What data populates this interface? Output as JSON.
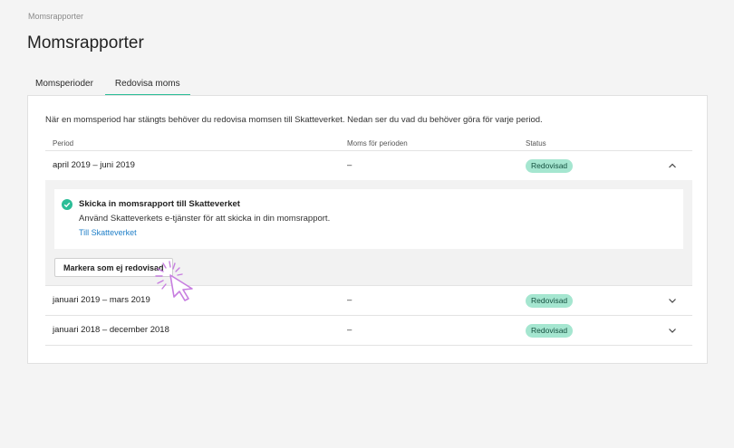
{
  "breadcrumb": "Momsrapporter",
  "page_title": "Momsrapporter",
  "tabs": [
    {
      "label": "Momsperioder",
      "active": false
    },
    {
      "label": "Redovisa moms",
      "active": true
    }
  ],
  "intro": "När en momsperiod har stängts behöver du redovisa momsen till Skatteverket. Nedan ser du vad du behöver göra för varje period.",
  "table": {
    "headers": [
      "Period",
      "Moms för perioden",
      "Status"
    ],
    "rows": [
      {
        "period": "april 2019 – juni 2019",
        "moms": "–",
        "status": "Redovisad",
        "expanded": true
      },
      {
        "period": "januari 2019 – mars 2019",
        "moms": "–",
        "status": "Redovisad",
        "expanded": false
      },
      {
        "period": "januari 2018 – december 2018",
        "moms": "–",
        "status": "Redovisad",
        "expanded": false
      }
    ]
  },
  "expanded": {
    "title": "Skicka in momsrapport till Skatteverket",
    "description": "Använd Skatteverkets e-tjänster för att skicka in din momsrapport.",
    "link": "Till Skatteverket",
    "button": "Markera som ej redovisad"
  },
  "colors": {
    "accent": "#2bbd97",
    "badge_bg": "#a5e6d0",
    "link": "#1f7fc8",
    "cursor": "#c77ee0"
  },
  "icons": {
    "check": "check-circle-icon",
    "chevron_up": "chevron-up-icon",
    "chevron_down": "chevron-down-icon",
    "cursor": "click-cursor-icon"
  }
}
